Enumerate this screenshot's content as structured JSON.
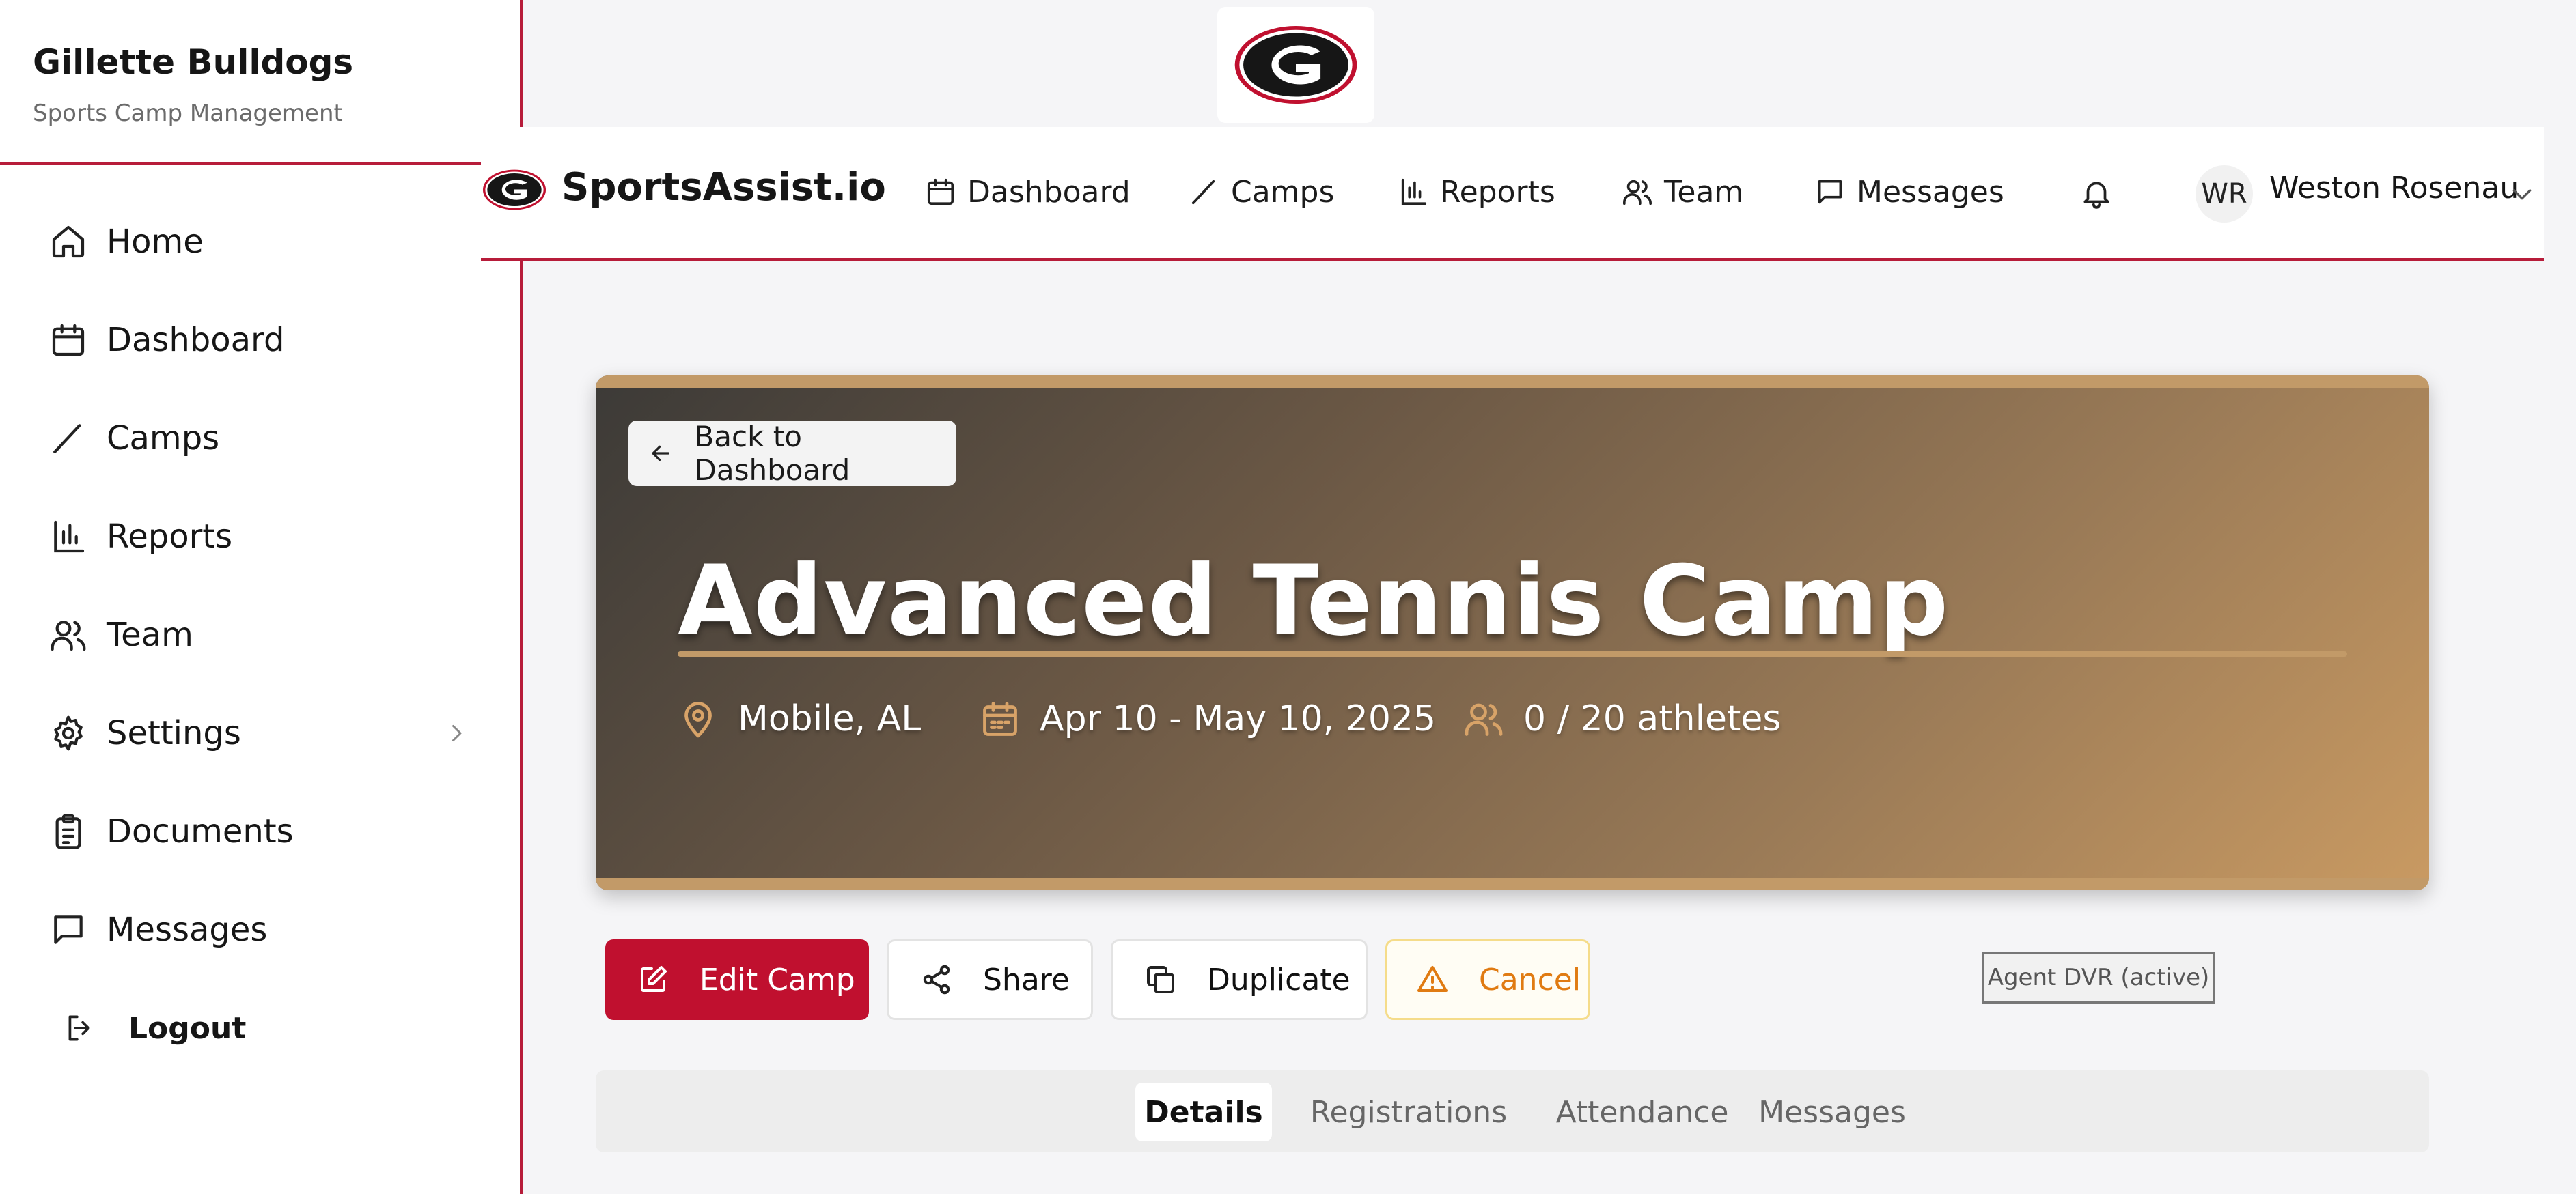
{
  "sidebar": {
    "title": "Gillette Bulldogs",
    "subtitle": "Sports Camp Management",
    "items": [
      {
        "label": "Home",
        "icon": "home-icon"
      },
      {
        "label": "Dashboard",
        "icon": "calendar-icon"
      },
      {
        "label": "Camps",
        "icon": "pencil-icon"
      },
      {
        "label": "Reports",
        "icon": "bar-chart-icon"
      },
      {
        "label": "Team",
        "icon": "users-icon"
      },
      {
        "label": "Settings",
        "icon": "gear-icon"
      },
      {
        "label": "Documents",
        "icon": "clipboard-icon"
      },
      {
        "label": "Messages",
        "icon": "message-icon"
      }
    ],
    "logout_label": "Logout"
  },
  "header": {
    "brand": "SportsAssist.io",
    "nav": [
      {
        "label": "Dashboard",
        "icon": "calendar-icon"
      },
      {
        "label": "Camps",
        "icon": "pencil-icon"
      },
      {
        "label": "Reports",
        "icon": "bar-chart-icon"
      },
      {
        "label": "Team",
        "icon": "users-icon"
      },
      {
        "label": "Messages",
        "icon": "message-icon"
      }
    ],
    "user_initials": "WR",
    "user_name": "Weston Rosenau"
  },
  "hero": {
    "back_label": "Back to Dashboard",
    "title": "Advanced Tennis Camp",
    "location": "Mobile, AL",
    "dates": "Apr 10 - May 10, 2025",
    "athletes": "0 / 20 athletes"
  },
  "actions": {
    "edit": "Edit Camp",
    "share": "Share",
    "duplicate": "Duplicate",
    "cancel": "Cancel"
  },
  "dvr_label": "Agent DVR (active)",
  "tabs": [
    {
      "label": "Details",
      "active": true
    },
    {
      "label": "Registrations",
      "active": false
    },
    {
      "label": "Attendance",
      "active": false
    },
    {
      "label": "Messages",
      "active": false
    }
  ],
  "colors": {
    "accent": "#c0102f",
    "border_red": "#b71c3a",
    "hero_gold": "#c29a68",
    "cancel_orange": "#e07b12"
  }
}
